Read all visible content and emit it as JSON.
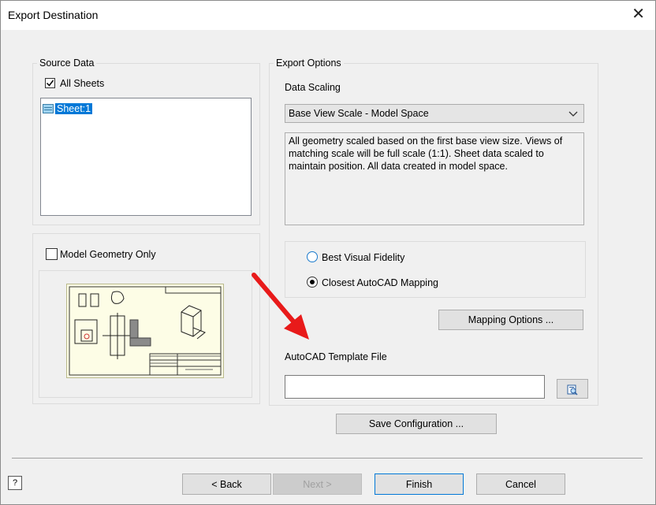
{
  "window": {
    "title": "Export Destination",
    "close_glyph": "✕"
  },
  "source_data": {
    "group_label": "Source Data",
    "all_sheets_label": "All Sheets",
    "all_sheets_checked": true,
    "sheets": [
      "Sheet:1"
    ],
    "model_geometry_label": "Model Geometry Only",
    "model_geometry_checked": false
  },
  "export_options": {
    "group_label": "Export Options",
    "data_scaling_label": "Data Scaling",
    "data_scaling_value": "Base View Scale - Model Space",
    "description": "All geometry scaled based on the first base view size. Views of matching scale will be full scale (1:1). Sheet data scaled to maintain position. All data created in model space.",
    "radio_best_visual": "Best Visual Fidelity",
    "radio_closest_autocad": "Closest AutoCAD Mapping",
    "selected_mode": "Closest AutoCAD Mapping",
    "mapping_button": "Mapping Options ...",
    "template_label": "AutoCAD Template File",
    "template_value": ""
  },
  "save_config_button": "Save Configuration ...",
  "footer": {
    "back": "< Back",
    "next": "Next >",
    "finish": "Finish",
    "cancel": "Cancel",
    "help_glyph": "?"
  },
  "colors": {
    "arrow": "#e81a1a",
    "selection": "#0078d7",
    "thumbnail_bg": "#fdfde6"
  }
}
